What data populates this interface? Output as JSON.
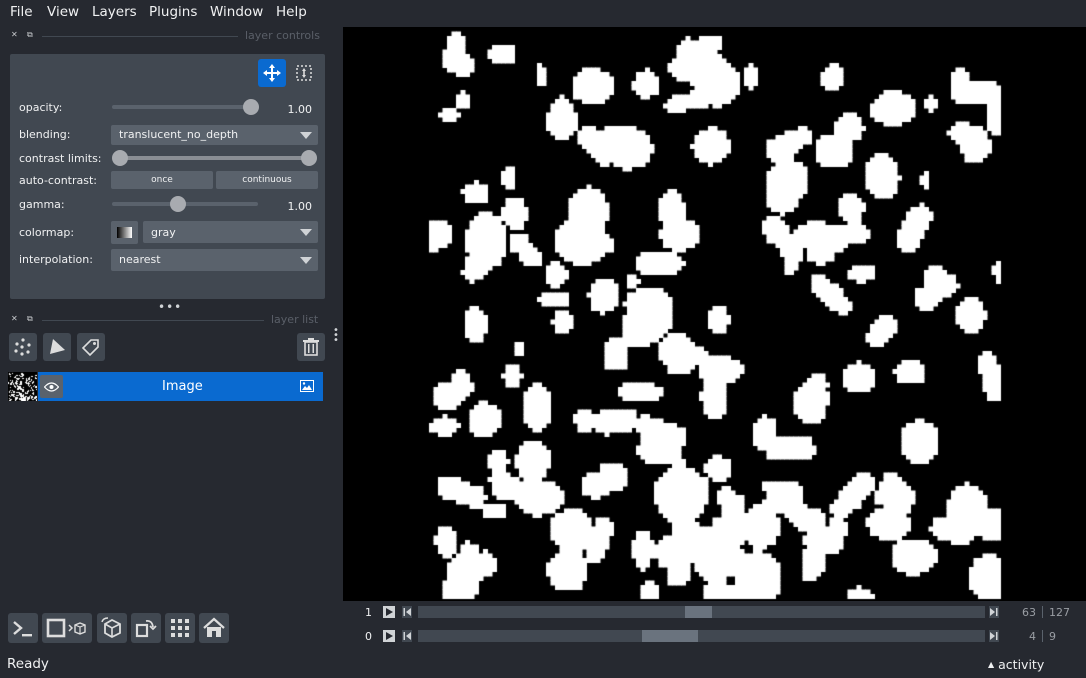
{
  "menu": [
    "File",
    "View",
    "Layers",
    "Plugins",
    "Window",
    "Help"
  ],
  "layer_controls": {
    "title": "layer controls",
    "opacity": {
      "label": "opacity:",
      "value": "1.00",
      "level": 1.0
    },
    "blending": {
      "label": "blending:",
      "value": "translucent_no_depth"
    },
    "contrast_limits": {
      "label": "contrast limits:",
      "low": 0.0,
      "high": 1.0
    },
    "auto_contrast": {
      "label": "auto-contrast:",
      "once": "once",
      "continuous": "continuous"
    },
    "gamma": {
      "label": "gamma:",
      "value": "1.00",
      "level": 0.5
    },
    "colormap": {
      "label": "colormap:",
      "value": "gray"
    },
    "interpolation": {
      "label": "interpolation:",
      "value": "nearest"
    }
  },
  "layer_list": {
    "title": "layer list",
    "layers": [
      {
        "name": "Image",
        "visible": true,
        "type": "image"
      }
    ]
  },
  "dims": [
    {
      "axis": "1",
      "current": "63",
      "max": "127",
      "position": 0.496
    },
    {
      "axis": "0",
      "current": "4",
      "max": "9",
      "position": 0.444
    }
  ],
  "status": "Ready",
  "activity": "activity",
  "colors": {
    "background": "#262930",
    "panel": "#414851",
    "accent": "#0a6ad0",
    "canvas": "#000000"
  },
  "icons": [
    "move-camera-icon",
    "transform-icon",
    "points-layer-icon",
    "shapes-layer-icon",
    "labels-layer-icon",
    "delete-layer-icon",
    "eye-icon",
    "image-type-icon",
    "console-icon",
    "ndisplay-icon",
    "roll-icon",
    "transpose-icon",
    "grid-icon",
    "home-icon"
  ]
}
